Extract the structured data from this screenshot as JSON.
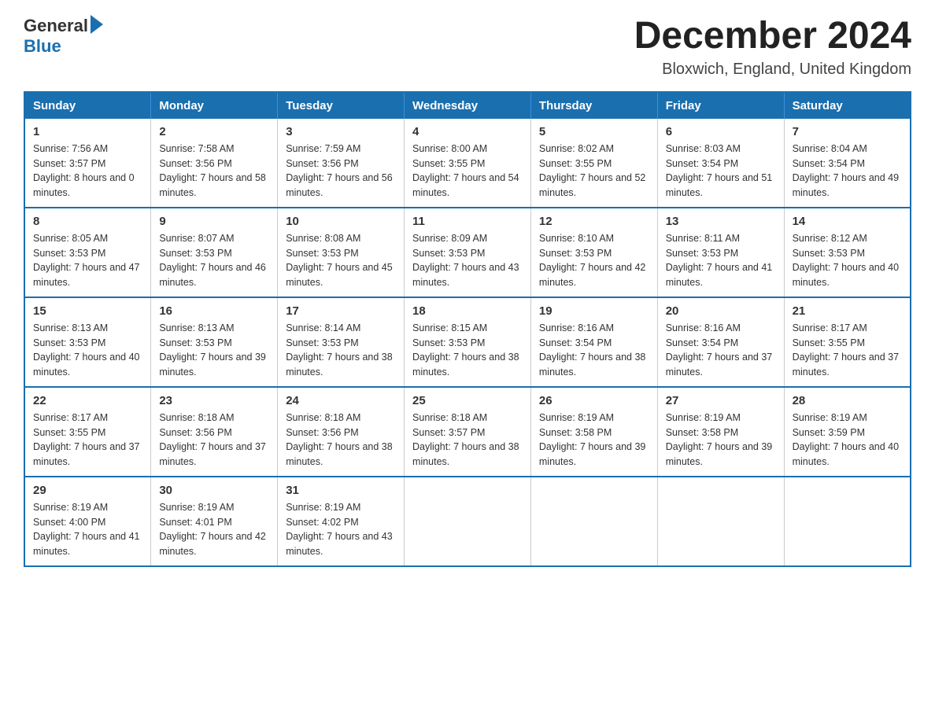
{
  "header": {
    "logo_general": "General",
    "logo_blue": "Blue",
    "month_title": "December 2024",
    "subtitle": "Bloxwich, England, United Kingdom"
  },
  "weekdays": [
    "Sunday",
    "Monday",
    "Tuesday",
    "Wednesday",
    "Thursday",
    "Friday",
    "Saturday"
  ],
  "weeks": [
    [
      {
        "day": "1",
        "sunrise": "7:56 AM",
        "sunset": "3:57 PM",
        "daylight": "8 hours and 0 minutes."
      },
      {
        "day": "2",
        "sunrise": "7:58 AM",
        "sunset": "3:56 PM",
        "daylight": "7 hours and 58 minutes."
      },
      {
        "day": "3",
        "sunrise": "7:59 AM",
        "sunset": "3:56 PM",
        "daylight": "7 hours and 56 minutes."
      },
      {
        "day": "4",
        "sunrise": "8:00 AM",
        "sunset": "3:55 PM",
        "daylight": "7 hours and 54 minutes."
      },
      {
        "day": "5",
        "sunrise": "8:02 AM",
        "sunset": "3:55 PM",
        "daylight": "7 hours and 52 minutes."
      },
      {
        "day": "6",
        "sunrise": "8:03 AM",
        "sunset": "3:54 PM",
        "daylight": "7 hours and 51 minutes."
      },
      {
        "day": "7",
        "sunrise": "8:04 AM",
        "sunset": "3:54 PM",
        "daylight": "7 hours and 49 minutes."
      }
    ],
    [
      {
        "day": "8",
        "sunrise": "8:05 AM",
        "sunset": "3:53 PM",
        "daylight": "7 hours and 47 minutes."
      },
      {
        "day": "9",
        "sunrise": "8:07 AM",
        "sunset": "3:53 PM",
        "daylight": "7 hours and 46 minutes."
      },
      {
        "day": "10",
        "sunrise": "8:08 AM",
        "sunset": "3:53 PM",
        "daylight": "7 hours and 45 minutes."
      },
      {
        "day": "11",
        "sunrise": "8:09 AM",
        "sunset": "3:53 PM",
        "daylight": "7 hours and 43 minutes."
      },
      {
        "day": "12",
        "sunrise": "8:10 AM",
        "sunset": "3:53 PM",
        "daylight": "7 hours and 42 minutes."
      },
      {
        "day": "13",
        "sunrise": "8:11 AM",
        "sunset": "3:53 PM",
        "daylight": "7 hours and 41 minutes."
      },
      {
        "day": "14",
        "sunrise": "8:12 AM",
        "sunset": "3:53 PM",
        "daylight": "7 hours and 40 minutes."
      }
    ],
    [
      {
        "day": "15",
        "sunrise": "8:13 AM",
        "sunset": "3:53 PM",
        "daylight": "7 hours and 40 minutes."
      },
      {
        "day": "16",
        "sunrise": "8:13 AM",
        "sunset": "3:53 PM",
        "daylight": "7 hours and 39 minutes."
      },
      {
        "day": "17",
        "sunrise": "8:14 AM",
        "sunset": "3:53 PM",
        "daylight": "7 hours and 38 minutes."
      },
      {
        "day": "18",
        "sunrise": "8:15 AM",
        "sunset": "3:53 PM",
        "daylight": "7 hours and 38 minutes."
      },
      {
        "day": "19",
        "sunrise": "8:16 AM",
        "sunset": "3:54 PM",
        "daylight": "7 hours and 38 minutes."
      },
      {
        "day": "20",
        "sunrise": "8:16 AM",
        "sunset": "3:54 PM",
        "daylight": "7 hours and 37 minutes."
      },
      {
        "day": "21",
        "sunrise": "8:17 AM",
        "sunset": "3:55 PM",
        "daylight": "7 hours and 37 minutes."
      }
    ],
    [
      {
        "day": "22",
        "sunrise": "8:17 AM",
        "sunset": "3:55 PM",
        "daylight": "7 hours and 37 minutes."
      },
      {
        "day": "23",
        "sunrise": "8:18 AM",
        "sunset": "3:56 PM",
        "daylight": "7 hours and 37 minutes."
      },
      {
        "day": "24",
        "sunrise": "8:18 AM",
        "sunset": "3:56 PM",
        "daylight": "7 hours and 38 minutes."
      },
      {
        "day": "25",
        "sunrise": "8:18 AM",
        "sunset": "3:57 PM",
        "daylight": "7 hours and 38 minutes."
      },
      {
        "day": "26",
        "sunrise": "8:19 AM",
        "sunset": "3:58 PM",
        "daylight": "7 hours and 39 minutes."
      },
      {
        "day": "27",
        "sunrise": "8:19 AM",
        "sunset": "3:58 PM",
        "daylight": "7 hours and 39 minutes."
      },
      {
        "day": "28",
        "sunrise": "8:19 AM",
        "sunset": "3:59 PM",
        "daylight": "7 hours and 40 minutes."
      }
    ],
    [
      {
        "day": "29",
        "sunrise": "8:19 AM",
        "sunset": "4:00 PM",
        "daylight": "7 hours and 41 minutes."
      },
      {
        "day": "30",
        "sunrise": "8:19 AM",
        "sunset": "4:01 PM",
        "daylight": "7 hours and 42 minutes."
      },
      {
        "day": "31",
        "sunrise": "8:19 AM",
        "sunset": "4:02 PM",
        "daylight": "7 hours and 43 minutes."
      },
      null,
      null,
      null,
      null
    ]
  ]
}
